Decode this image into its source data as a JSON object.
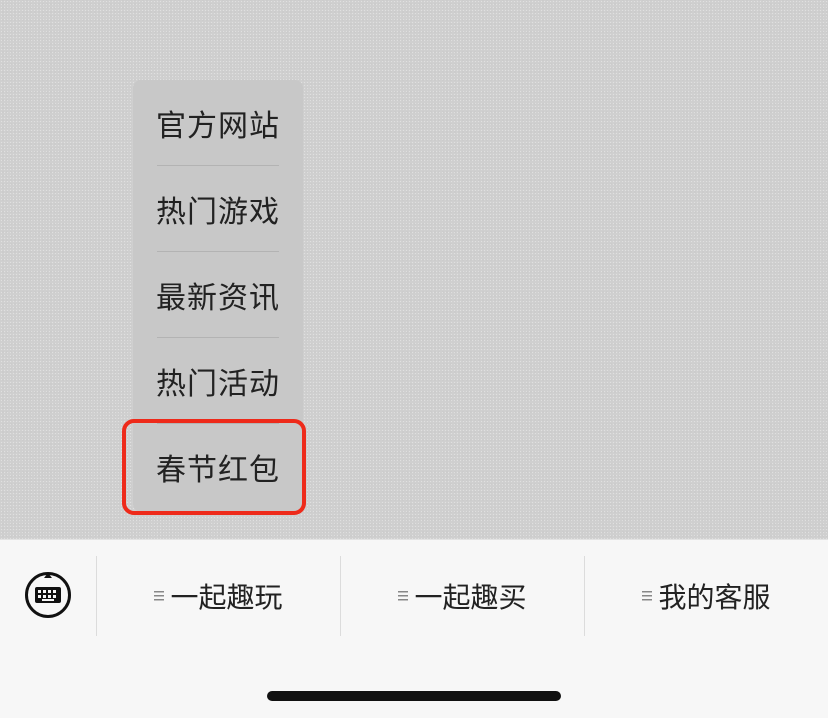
{
  "popup_menu": {
    "items": [
      {
        "label": "官方网站"
      },
      {
        "label": "热门游戏"
      },
      {
        "label": "最新资讯"
      },
      {
        "label": "热门活动"
      },
      {
        "label": "春节红包"
      }
    ],
    "highlighted_index": 4,
    "highlight_color": "#ee2a1a"
  },
  "bottom_bar": {
    "keyboard_icon": "keyboard-icon",
    "menus": [
      {
        "label": "一起趣玩",
        "icon": "list-icon"
      },
      {
        "label": "一起趣买",
        "icon": "list-icon"
      },
      {
        "label": "我的客服",
        "icon": "list-icon"
      }
    ]
  },
  "colors": {
    "chat_background": "#cfcfcf",
    "menu_background": "#c8c8c8",
    "bar_background": "#f7f7f7"
  }
}
